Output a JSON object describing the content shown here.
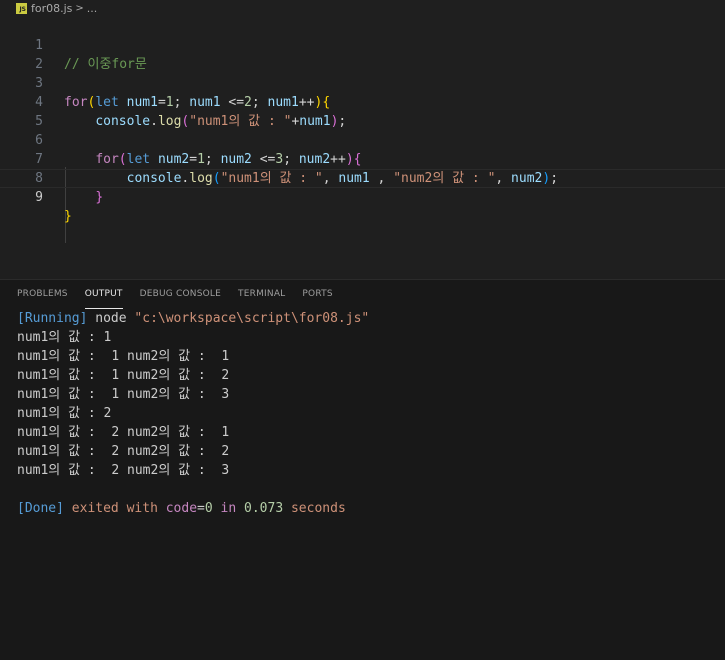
{
  "breadcrumb": {
    "file_badge": "JS",
    "file": "for08.js",
    "separator": ">",
    "rest": "..."
  },
  "editor": {
    "lines": [
      {
        "n": "1"
      },
      {
        "n": "2"
      },
      {
        "n": "3"
      },
      {
        "n": "4"
      },
      {
        "n": "5"
      },
      {
        "n": "6"
      },
      {
        "n": "7"
      },
      {
        "n": "8"
      },
      {
        "n": "9"
      }
    ],
    "tokens": {
      "l1": {
        "comment": "// 이중for문"
      },
      "l3": {
        "for": "for",
        "p1": "(",
        "let": "let",
        "var1": "num1",
        "eq1": "=",
        "one": "1",
        "semi1": "; ",
        "var2": "num1",
        "le": " <=",
        "two": "2",
        "semi2": "; ",
        "var3": "num1",
        "inc": "++",
        "p2": ")",
        "brace": "{"
      },
      "l4": {
        "obj": "console",
        "dot": ".",
        "fn": "log",
        "p1": "(",
        "str": "\"num1의 값 : \"",
        "plus": "+",
        "var": "num1",
        "p2": ")",
        "semi": ";"
      },
      "l6": {
        "for": "for",
        "p1": "(",
        "let": "let",
        "var1": "num2",
        "eq1": "=",
        "one": "1",
        "semi1": "; ",
        "var2": "num2",
        "le": " <=",
        "three": "3",
        "semi2": "; ",
        "var3": "num2",
        "inc": "++",
        "p2": ")",
        "brace": "{"
      },
      "l7": {
        "obj": "console",
        "dot": ".",
        "fn": "log",
        "p1": "(",
        "str1": "\"num1의 값 : \"",
        "c1": ", ",
        "var1": "num1",
        "c2": " , ",
        "str2": "\"num2의 값 : \"",
        "c3": ", ",
        "var2": "num2",
        "p2": ")",
        "semi": ";"
      },
      "l8": {
        "brace": "}"
      },
      "l9": {
        "brace": "}"
      }
    }
  },
  "panel": {
    "tabs": [
      {
        "label": "PROBLEMS"
      },
      {
        "label": "OUTPUT"
      },
      {
        "label": "DEBUG CONSOLE"
      },
      {
        "label": "TERMINAL"
      },
      {
        "label": "PORTS"
      }
    ],
    "running": {
      "tag": "[Running]",
      "cmd": " node ",
      "path": "\"c:\\workspace\\script\\for08.js\""
    },
    "output_lines": [
      "num1의 값 : 1",
      "num1의 값 :  1 num2의 값 :  1",
      "num1의 값 :  1 num2의 값 :  2",
      "num1의 값 :  1 num2의 값 :  3",
      "num1의 값 : 2",
      "num1의 값 :  2 num2의 값 :  1",
      "num1의 값 :  2 num2의 값 :  2",
      "num1의 값 :  2 num2의 값 :  3"
    ],
    "done": {
      "tag": "[Done]",
      "t1": " exited ",
      "with": "with",
      "t2": " ",
      "code": "code",
      "eq": "=",
      "zero": "0",
      "t3": " ",
      "in": "in",
      "t4": " ",
      "time": "0.073",
      "t5": " seconds"
    }
  }
}
